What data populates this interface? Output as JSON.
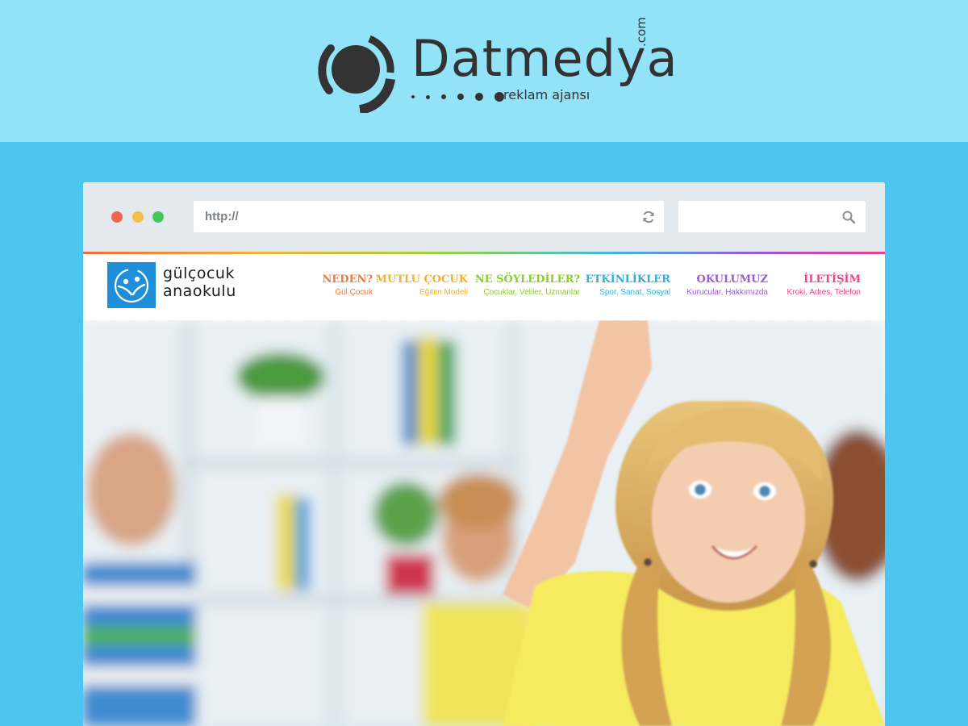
{
  "brand": {
    "name": "Datmedya",
    "tld": ".com",
    "tagline": "reklam ajansı"
  },
  "browser": {
    "url_placeholder": "http://",
    "search_placeholder": ""
  },
  "site": {
    "logo_line1": "gülçocuk",
    "logo_line2": "anaokulu",
    "nav": [
      {
        "title": "NEDEN?",
        "subtitle": "Gül Çocuk",
        "color": "#f07a3c"
      },
      {
        "title": "MUTLU ÇOCUK",
        "subtitle": "Eğitim Modeli",
        "color": "#f3b12f"
      },
      {
        "title": "NE SÖYLEDİLER?",
        "subtitle": "Çocuklar, Veliler, Uzmanlar",
        "color": "#8ccd2c"
      },
      {
        "title": "ETKİNLİKLER",
        "subtitle": "Spor, Sanat, Sosyal",
        "color": "#32b1d8"
      },
      {
        "title": "OKULUMUZ",
        "subtitle": "Kurucular, Hakkımızda",
        "color": "#9a5bd4"
      },
      {
        "title": "İLETİŞİM",
        "subtitle": "Kroki, Adres, Telefon",
        "color": "#e6468b"
      }
    ]
  },
  "colors": {
    "top_band": "#93e3f8",
    "page_background": "#4cc6ee",
    "logo_dark": "#333333",
    "site_logo_blue": "#1f8fda"
  }
}
